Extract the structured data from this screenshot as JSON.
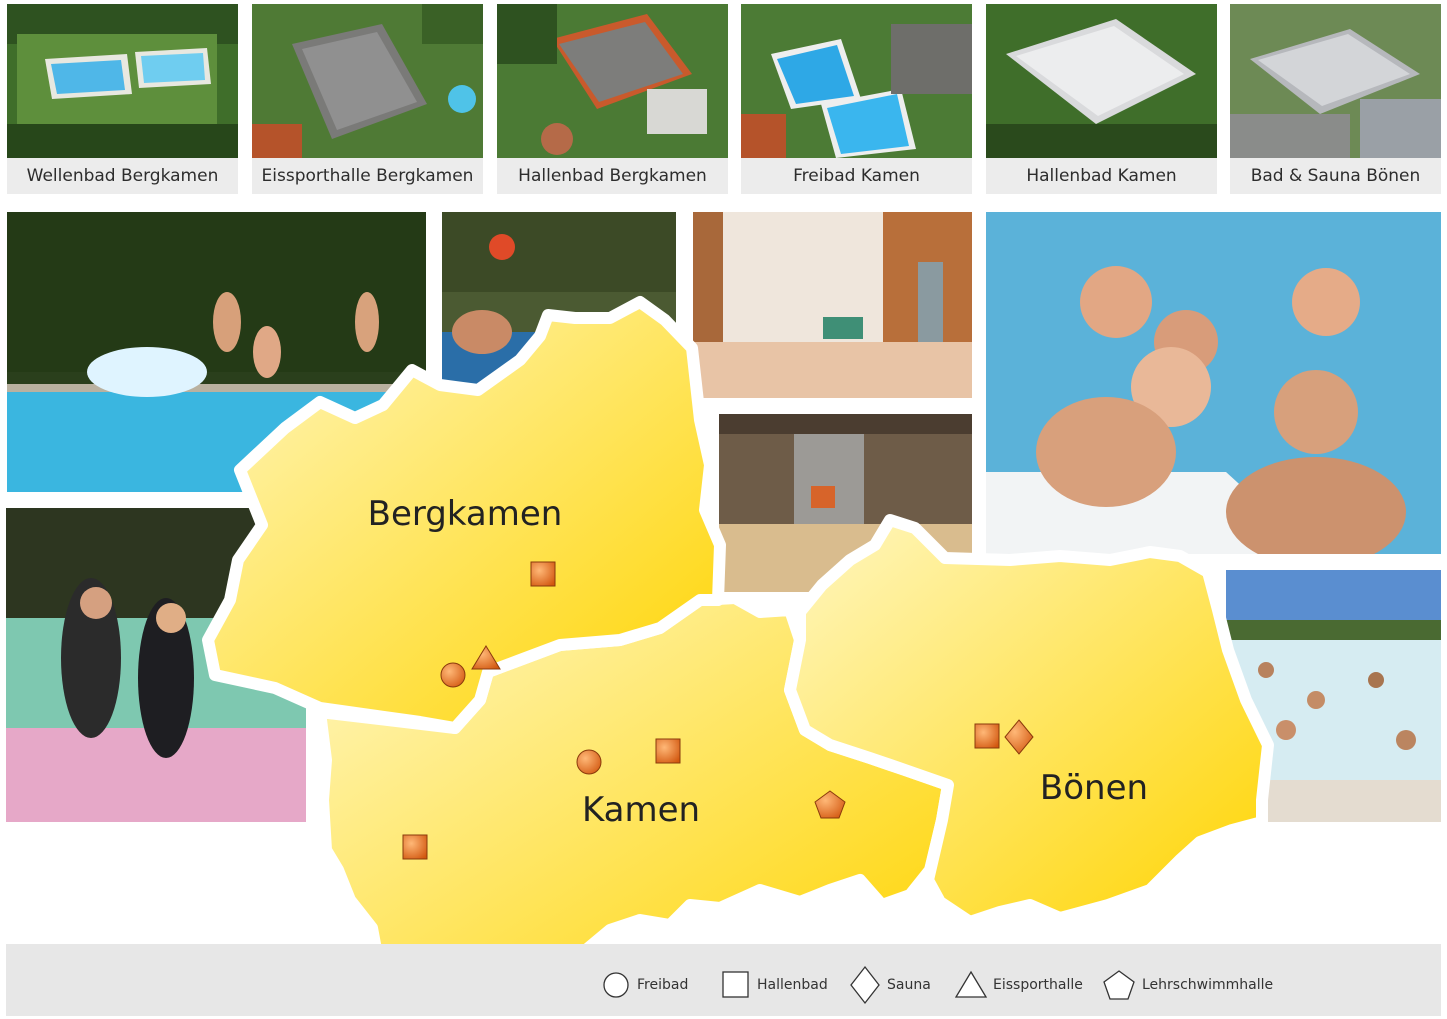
{
  "facilities": [
    {
      "name": "Wellenbad Bergkamen"
    },
    {
      "name": "Eissporthalle Bergkamen"
    },
    {
      "name": "Hallenbad Bergkamen"
    },
    {
      "name": "Freibad Kamen"
    },
    {
      "name": "Hallenbad Kamen"
    },
    {
      "name": "Bad & Sauna Bönen"
    }
  ],
  "towns": {
    "bergkamen": "Bergkamen",
    "kamen": "Kamen",
    "boenen": "Bönen"
  },
  "legend": {
    "freibad": "Freibad",
    "hallenbad": "Hallenbad",
    "sauna": "Sauna",
    "eissporthalle": "Eissporthalle",
    "lehrschwimmhalle": "Lehrschwimmhalle"
  },
  "colors": {
    "region_light": "#fff7c2",
    "region_dark": "#ffd400",
    "marker_light": "#ffb877",
    "marker_dark": "#d2570f",
    "marker_stroke": "#8a3a0c"
  },
  "icons": [
    "circle-icon",
    "square-icon",
    "diamond-icon",
    "triangle-icon",
    "pentagon-icon"
  ]
}
